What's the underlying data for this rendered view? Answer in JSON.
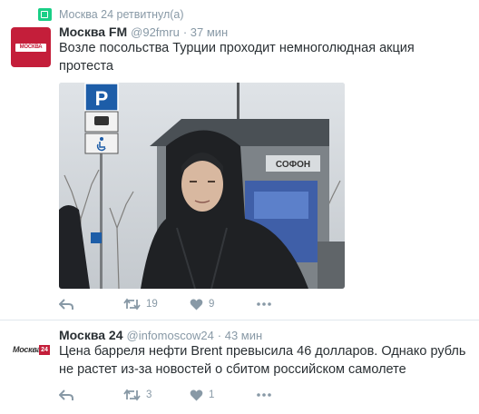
{
  "tweets": [
    {
      "retweet_context": "Москва 24 ретвитнул(а)",
      "avatar_text": "МОСКВА FM",
      "name": "Москва FM",
      "handle": "@92fmru",
      "time": "· 37 мин",
      "text": "Возле посольства Турции проходит немноголюдная акция протеста",
      "photo_sign_text": "СОФОН",
      "actions": {
        "retweets": "19",
        "likes": "9"
      }
    },
    {
      "avatar_text": "Москва",
      "avatar_number": "24",
      "name": "Москва 24",
      "handle": "@infomoscow24",
      "time": "· 43 мин",
      "text": "Цена барреля нефти Brent превысила 46 долларов. Однако рубль не растет из-за новостей о сбитом российском самолете",
      "actions": {
        "retweets": "3",
        "likes": "1"
      }
    }
  ],
  "colors": {
    "retweet": "#19cf86",
    "muted": "#8899a6",
    "text": "#292f33",
    "brand_red": "#c41e3a",
    "divider": "#e1e8ed"
  },
  "icons": [
    "retweet-icon",
    "reply-icon",
    "heart-icon",
    "more-icon",
    "parking-sign-icon",
    "bus-sign-icon",
    "wheelchair-sign-icon"
  ]
}
